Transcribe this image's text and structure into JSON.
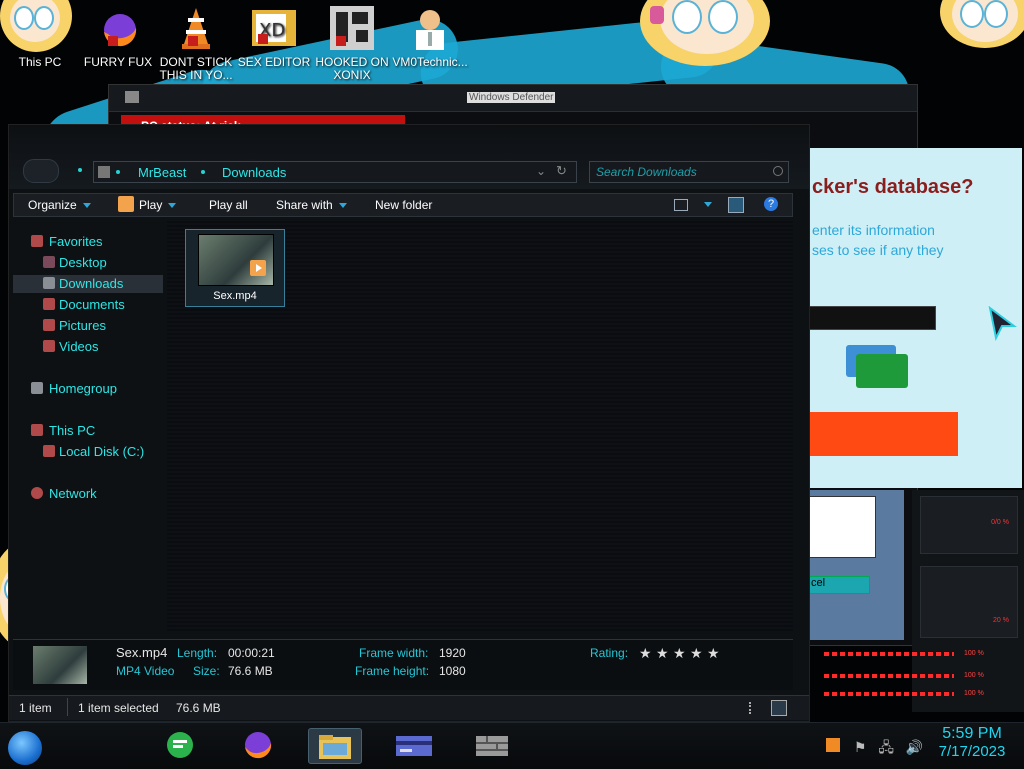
{
  "desktop": {
    "icons": [
      {
        "label": "This PC",
        "icon": "this-pc-icon"
      },
      {
        "label": "FURRY FUX",
        "icon": "firefox-icon"
      },
      {
        "label": "DONT STICK THIS IN YO...",
        "icon": "vlc-icon"
      },
      {
        "label": "SEX EDITOR",
        "icon": "xd-icon"
      },
      {
        "label": "HOOKED ON XONIX",
        "icon": "xonix-icon"
      },
      {
        "label": "VM0Technic...",
        "icon": "doctor-icon"
      }
    ]
  },
  "background_window": {
    "title": "Windows Defender",
    "status": "PC status: At risk"
  },
  "popup": {
    "heading": "cker's database?",
    "line1": "enter its information",
    "line2": "ses to see if any they",
    "cancel_label": "cel"
  },
  "explorer": {
    "breadcrumb": [
      "MrBeast",
      "Downloads"
    ],
    "search_placeholder": "Search Downloads",
    "commands": {
      "organize": "Organize",
      "play": "Play",
      "play_all": "Play all",
      "share_with": "Share with",
      "new_folder": "New folder"
    },
    "nav": {
      "favorites": "Favorites",
      "desktop": "Desktop",
      "downloads": "Downloads",
      "documents": "Documents",
      "pictures": "Pictures",
      "videos": "Videos",
      "homegroup": "Homegroup",
      "this_pc": "This PC",
      "local_disk": "Local Disk (C:)",
      "network": "Network"
    },
    "files": [
      {
        "name": "Sex.mp4"
      }
    ],
    "details": {
      "name": "Sex.mp4",
      "type": "MP4 Video",
      "length_label": "Length:",
      "length": "00:00:21",
      "size_label": "Size:",
      "size": "76.6 MB",
      "frame_width_label": "Frame width:",
      "frame_width": "1920",
      "frame_height_label": "Frame height:",
      "frame_height": "1080",
      "rating_label": "Rating:",
      "rating_stars": 0
    },
    "status": {
      "count": "1 item",
      "selected": "1 item selected",
      "selected_size": "76.6 MB"
    }
  },
  "right_panel": {
    "readouts": [
      "0/0 %",
      "20 %",
      "100 %",
      "100 %",
      "100 %"
    ]
  },
  "taskbar": {
    "apps": [
      "feedly-icon",
      "firefox-icon",
      "file-explorer-icon",
      "card-app-icon",
      "wall-app-icon"
    ],
    "time": "5:59 PM",
    "date": "7/17/2023"
  }
}
